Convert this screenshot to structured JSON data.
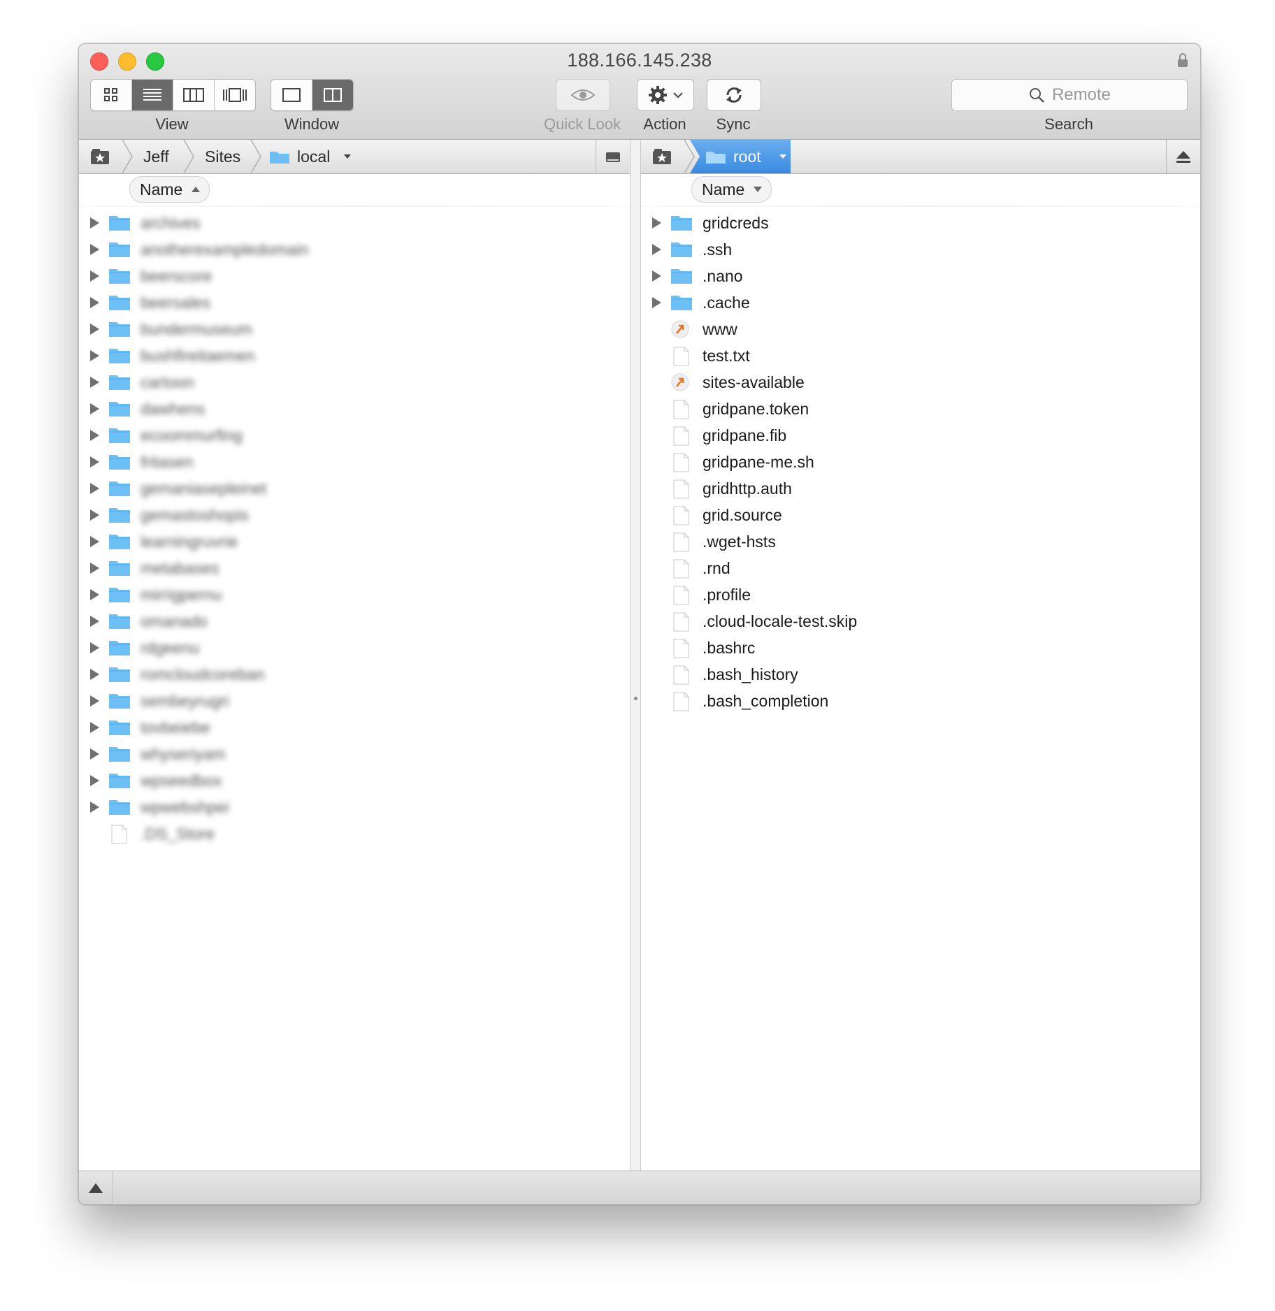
{
  "window": {
    "title": "188.166.145.238"
  },
  "toolbar": {
    "view_label": "View",
    "window_label": "Window",
    "quicklook_label": "Quick Look",
    "action_label": "Action",
    "sync_label": "Sync",
    "search_placeholder": "Remote",
    "search_label": "Search",
    "view_selected": "list",
    "window_selected": "dual-pane"
  },
  "left_pane": {
    "breadcrumb": [
      "Jeff",
      "Sites",
      "local"
    ],
    "column_header": "Name",
    "sort": "ascending",
    "rows": [
      {
        "type": "folder",
        "name": "archives"
      },
      {
        "type": "folder",
        "name": "anotherexampledomain"
      },
      {
        "type": "folder",
        "name": "beerscore"
      },
      {
        "type": "folder",
        "name": "beersales"
      },
      {
        "type": "folder",
        "name": "bundermuseum"
      },
      {
        "type": "folder",
        "name": "bushfireitaemen"
      },
      {
        "type": "folder",
        "name": "cartoon"
      },
      {
        "type": "folder",
        "name": "dawhens"
      },
      {
        "type": "folder",
        "name": "ecoommurfing"
      },
      {
        "type": "folder",
        "name": "fritasen"
      },
      {
        "type": "folder",
        "name": "gemaniasepleinet"
      },
      {
        "type": "folder",
        "name": "gemastoshopis"
      },
      {
        "type": "folder",
        "name": "learningruvrie"
      },
      {
        "type": "folder",
        "name": "metabases"
      },
      {
        "type": "folder",
        "name": "mirrigpernu"
      },
      {
        "type": "folder",
        "name": "omanado"
      },
      {
        "type": "folder",
        "name": "rdgeenu"
      },
      {
        "type": "folder",
        "name": "romcloudcoreban"
      },
      {
        "type": "folder",
        "name": "sembeyrugri"
      },
      {
        "type": "folder",
        "name": "tovbeiebe"
      },
      {
        "type": "folder",
        "name": "whyseriyam"
      },
      {
        "type": "folder",
        "name": "wpseedbox"
      },
      {
        "type": "folder",
        "name": "wpwebshpei"
      },
      {
        "type": "file",
        "name": ".DS_Store"
      }
    ]
  },
  "right_pane": {
    "breadcrumb": [
      "root"
    ],
    "column_header": "Name",
    "sort": "descending",
    "rows": [
      {
        "type": "folder",
        "name": "gridcreds"
      },
      {
        "type": "folder",
        "name": ".ssh"
      },
      {
        "type": "folder",
        "name": ".nano"
      },
      {
        "type": "folder",
        "name": ".cache"
      },
      {
        "type": "symlink",
        "name": "www"
      },
      {
        "type": "file",
        "name": "test.txt"
      },
      {
        "type": "symlink",
        "name": "sites-available"
      },
      {
        "type": "file",
        "name": "gridpane.token"
      },
      {
        "type": "file",
        "name": "gridpane.fib"
      },
      {
        "type": "file",
        "name": "gridpane-me.sh"
      },
      {
        "type": "file",
        "name": "gridhttp.auth"
      },
      {
        "type": "file",
        "name": "grid.source"
      },
      {
        "type": "file",
        "name": ".wget-hsts"
      },
      {
        "type": "file",
        "name": ".rnd"
      },
      {
        "type": "file",
        "name": ".profile"
      },
      {
        "type": "file",
        "name": ".cloud-locale-test.skip"
      },
      {
        "type": "file",
        "name": ".bashrc"
      },
      {
        "type": "file",
        "name": ".bash_history"
      },
      {
        "type": "file",
        "name": ".bash_completion"
      }
    ]
  },
  "colors": {
    "folder": "#6cc0f5",
    "selection": "#3a8ae0",
    "symlink_arrow": "#e8721c"
  }
}
